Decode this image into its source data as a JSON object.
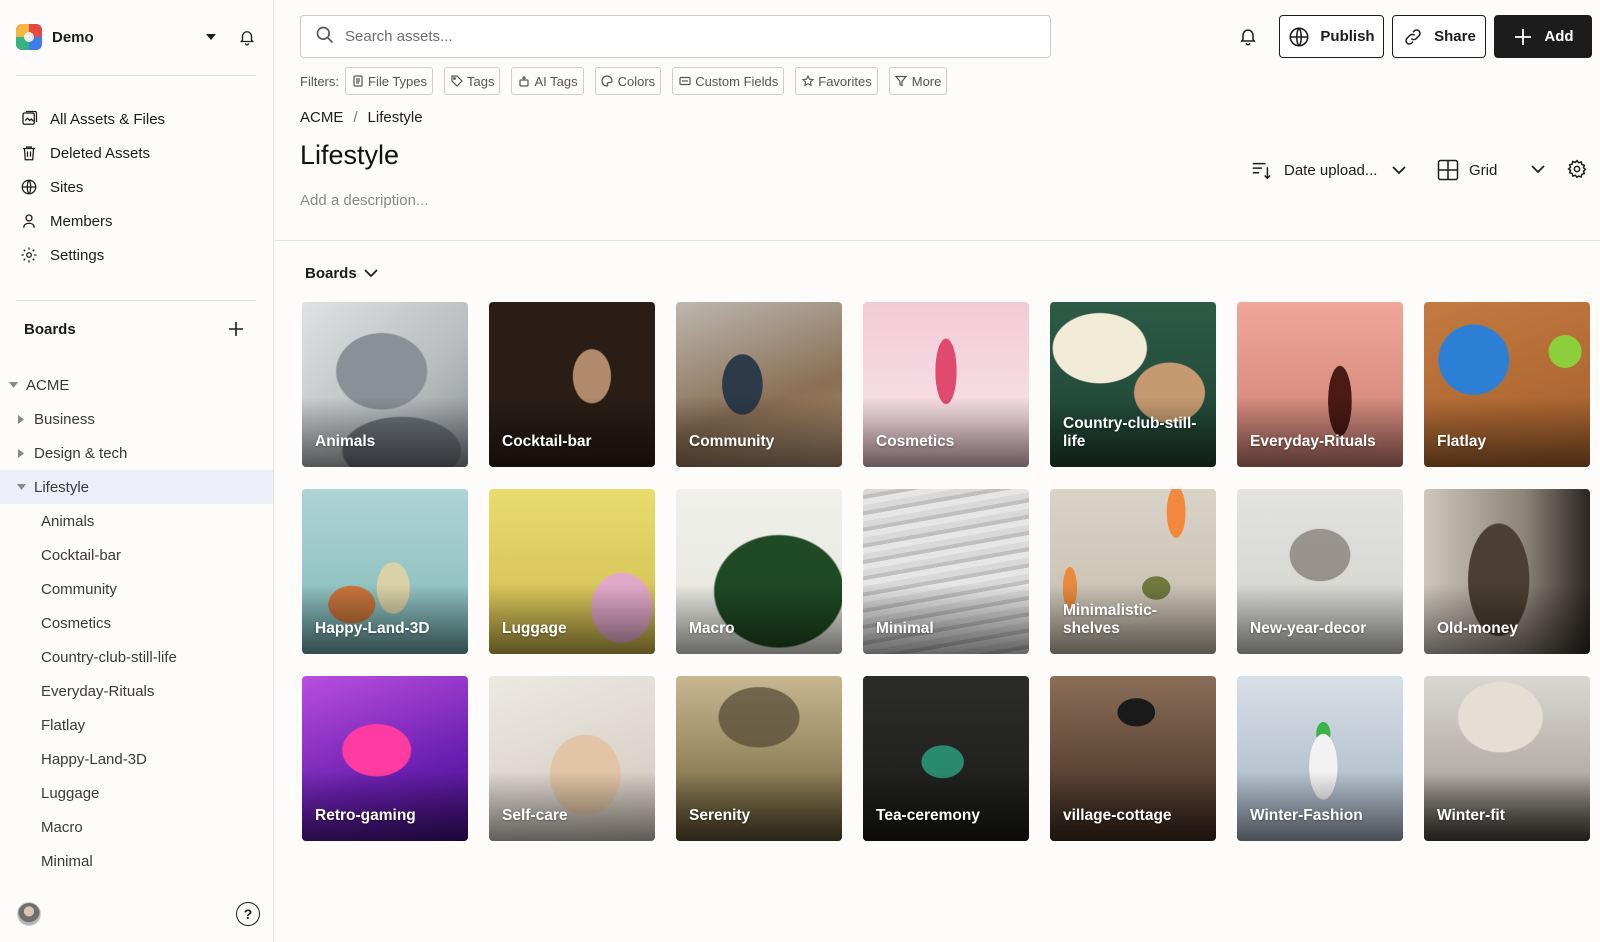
{
  "workspace": {
    "name": "Demo"
  },
  "nav": [
    {
      "label": "All Assets & Files",
      "icon": "assets-icon"
    },
    {
      "label": "Deleted Assets",
      "icon": "trash-icon"
    },
    {
      "label": "Sites",
      "icon": "globe-icon"
    },
    {
      "label": "Members",
      "icon": "person-icon"
    },
    {
      "label": "Settings",
      "icon": "gear-icon"
    }
  ],
  "sidebar_boards": {
    "title": "Boards",
    "tree": [
      {
        "label": "ACME",
        "level": 0,
        "twisty": "open"
      },
      {
        "label": "Business",
        "level": 1,
        "twisty": "closed"
      },
      {
        "label": "Design & tech",
        "level": 1,
        "twisty": "closed"
      },
      {
        "label": "Lifestyle",
        "level": 1,
        "twisty": "open",
        "active": true
      },
      {
        "label": "Animals",
        "level": 2
      },
      {
        "label": "Cocktail-bar",
        "level": 2
      },
      {
        "label": "Community",
        "level": 2
      },
      {
        "label": "Cosmetics",
        "level": 2
      },
      {
        "label": "Country-club-still-life",
        "level": 2
      },
      {
        "label": "Everyday-Rituals",
        "level": 2
      },
      {
        "label": "Flatlay",
        "level": 2
      },
      {
        "label": "Happy-Land-3D",
        "level": 2
      },
      {
        "label": "Luggage",
        "level": 2
      },
      {
        "label": "Macro",
        "level": 2
      },
      {
        "label": "Minimal",
        "level": 2
      }
    ]
  },
  "search": {
    "placeholder": "Search assets...",
    "value": ""
  },
  "actions": {
    "publish": "Publish",
    "share": "Share",
    "add": "Add"
  },
  "filters": {
    "label": "Filters:",
    "chips": [
      "File Types",
      "Tags",
      "AI Tags",
      "Colors",
      "Custom Fields",
      "Favorites",
      "More"
    ]
  },
  "breadcrumb": {
    "root": "ACME",
    "separator": "/",
    "current": "Lifestyle"
  },
  "page": {
    "title": "Lifestyle",
    "description_placeholder": "Add a description..."
  },
  "sort": {
    "label": "Date upload..."
  },
  "view": {
    "label": "Grid"
  },
  "boards_section": {
    "label": "Boards"
  },
  "boards": [
    {
      "label": "Animals",
      "thumb": "animals"
    },
    {
      "label": "Cocktail-bar",
      "thumb": "cocktail"
    },
    {
      "label": "Community",
      "thumb": "community"
    },
    {
      "label": "Cosmetics",
      "thumb": "cosmetics"
    },
    {
      "label": "Country-club-still-life",
      "thumb": "country"
    },
    {
      "label": "Everyday-Rituals",
      "thumb": "everyday"
    },
    {
      "label": "Flatlay",
      "thumb": "flatlay"
    },
    {
      "label": "Happy-Land-3D",
      "thumb": "happy"
    },
    {
      "label": "Luggage",
      "thumb": "luggage"
    },
    {
      "label": "Macro",
      "thumb": "macro"
    },
    {
      "label": "Minimal",
      "thumb": "minimal"
    },
    {
      "label": "Minimalistic-shelves",
      "thumb": "shelves"
    },
    {
      "label": "New-year-decor",
      "thumb": "newyear"
    },
    {
      "label": "Old-money",
      "thumb": "oldmoney"
    },
    {
      "label": "Retro-gaming",
      "thumb": "retro"
    },
    {
      "label": "Self-care",
      "thumb": "selfcare"
    },
    {
      "label": "Serenity",
      "thumb": "serenity"
    },
    {
      "label": "Tea-ceremony",
      "thumb": "tea"
    },
    {
      "label": "village-cottage",
      "thumb": "village"
    },
    {
      "label": "Winter-Fashion",
      "thumb": "winterf"
    },
    {
      "label": "Winter-fit",
      "thumb": "winterfit"
    }
  ],
  "colors": {
    "active_row": "#eceef8",
    "dark_button": "#1c1c1c",
    "border": "#cfcdc9"
  }
}
